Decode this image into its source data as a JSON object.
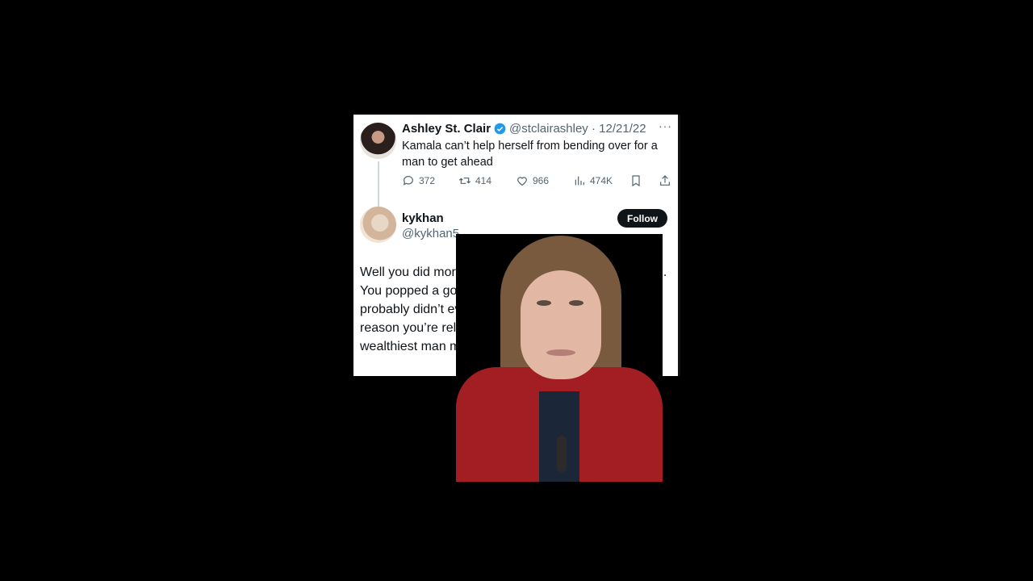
{
  "tweet": {
    "author_name": "Ashley St. Clair",
    "author_handle": "@stclairashley",
    "date": "12/21/22",
    "text": "Kamala can’t help herself from bending over for a man to get ahead",
    "replies": "372",
    "retweets": "414",
    "likes": "966",
    "views": "474K",
    "more": "···"
  },
  "reply": {
    "author_name": "kykhan",
    "author_handle": "@kykhan5",
    "follow_label": "Follow",
    "text": "Well you did more than bend over for a powerful man. You popped a got his kid out of your coochie and he probably didn’t even spend Valentine’s Day. The only reason you’re relevant is because the world’s wealthiest man made you pop it."
  },
  "colors": {
    "verified": "#1d9bf0",
    "follow_bg": "#0f1419",
    "redaction": "#c2185b",
    "jacket": "#a31e22"
  },
  "icons": [
    "reply-icon",
    "retweet-icon",
    "like-icon",
    "views-icon",
    "bookmark-icon",
    "share-icon",
    "verified-badge-icon"
  ]
}
